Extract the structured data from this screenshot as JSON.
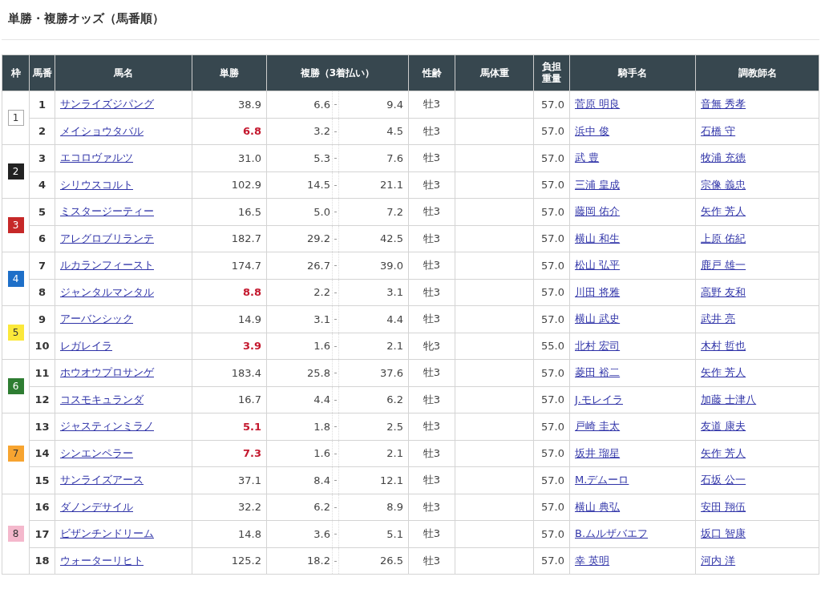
{
  "title": "単勝・複勝オッズ（馬番順）",
  "columns": [
    "枠",
    "馬番",
    "馬名",
    "単勝",
    "複勝（3着払い）",
    "性齢",
    "馬体重",
    "負担重量",
    "騎手名",
    "調教師名"
  ],
  "brackets": [
    {
      "number": "1",
      "color": "#ffffff",
      "horses": [
        {
          "no": "1",
          "name": "サンライズジパング",
          "win": "38.9",
          "highlight": false,
          "place_low": "6.6",
          "sep": "-",
          "place_high": "9.4",
          "sex_age": "牡3",
          "weight": "57.0",
          "jockey": "菅原 明良",
          "trainer": "音無 秀孝"
        },
        {
          "no": "2",
          "name": "メイショウタバル",
          "win": "6.8",
          "highlight": true,
          "place_low": "3.2",
          "sep": "-",
          "place_high": "4.5",
          "sex_age": "牡3",
          "weight": "57.0",
          "jockey": "浜中 俊",
          "trainer": "石橋 守"
        }
      ]
    },
    {
      "number": "2",
      "color": "#222222",
      "horses": [
        {
          "no": "3",
          "name": "エコロヴァルツ",
          "win": "31.0",
          "highlight": false,
          "place_low": "5.3",
          "sep": "-",
          "place_high": "7.6",
          "sex_age": "牡3",
          "weight": "57.0",
          "jockey": "武 豊",
          "trainer": "牧浦 充徳"
        },
        {
          "no": "4",
          "name": "シリウスコルト",
          "win": "102.9",
          "highlight": false,
          "place_low": "14.5",
          "sep": "-",
          "place_high": "21.1",
          "sex_age": "牡3",
          "weight": "57.0",
          "jockey": "三浦 皇成",
          "trainer": "宗像 義忠"
        }
      ]
    },
    {
      "number": "3",
      "color": "#c62828",
      "horses": [
        {
          "no": "5",
          "name": "ミスタージーティー",
          "win": "16.5",
          "highlight": false,
          "place_low": "5.0",
          "sep": "-",
          "place_high": "7.2",
          "sex_age": "牡3",
          "weight": "57.0",
          "jockey": "藤岡 佑介",
          "trainer": "矢作 芳人"
        },
        {
          "no": "6",
          "name": "アレグロブリランテ",
          "win": "182.7",
          "highlight": false,
          "place_low": "29.2",
          "sep": "-",
          "place_high": "42.5",
          "sex_age": "牡3",
          "weight": "57.0",
          "jockey": "横山 和生",
          "trainer": "上原 佑紀"
        }
      ]
    },
    {
      "number": "4",
      "color": "#1e6fc8",
      "horses": [
        {
          "no": "7",
          "name": "ルカランフィースト",
          "win": "174.7",
          "highlight": false,
          "place_low": "26.7",
          "sep": "-",
          "place_high": "39.0",
          "sex_age": "牡3",
          "weight": "57.0",
          "jockey": "松山 弘平",
          "trainer": "鹿戸 雄一"
        },
        {
          "no": "8",
          "name": "ジャンタルマンタル",
          "win": "8.8",
          "highlight": true,
          "place_low": "2.2",
          "sep": "-",
          "place_high": "3.1",
          "sex_age": "牡3",
          "weight": "57.0",
          "jockey": "川田 将雅",
          "trainer": "高野 友和"
        }
      ]
    },
    {
      "number": "5",
      "color": "#fbe83a",
      "horses": [
        {
          "no": "9",
          "name": "アーバンシック",
          "win": "14.9",
          "highlight": false,
          "place_low": "3.1",
          "sep": "-",
          "place_high": "4.4",
          "sex_age": "牡3",
          "weight": "57.0",
          "jockey": "横山 武史",
          "trainer": "武井 亮"
        },
        {
          "no": "10",
          "name": "レガレイラ",
          "win": "3.9",
          "highlight": true,
          "place_low": "1.6",
          "sep": "-",
          "place_high": "2.1",
          "sex_age": "牝3",
          "weight": "55.0",
          "jockey": "北村 宏司",
          "trainer": "木村 哲也"
        }
      ]
    },
    {
      "number": "6",
      "color": "#2e7d32",
      "horses": [
        {
          "no": "11",
          "name": "ホウオウプロサンゲ",
          "win": "183.4",
          "highlight": false,
          "place_low": "25.8",
          "sep": "-",
          "place_high": "37.6",
          "sex_age": "牡3",
          "weight": "57.0",
          "jockey": "菱田 裕二",
          "trainer": "矢作 芳人"
        },
        {
          "no": "12",
          "name": "コスモキュランダ",
          "win": "16.7",
          "highlight": false,
          "place_low": "4.4",
          "sep": "-",
          "place_high": "6.2",
          "sex_age": "牡3",
          "weight": "57.0",
          "jockey": "J.モレイラ",
          "trainer": "加藤 士津八"
        }
      ]
    },
    {
      "number": "7",
      "color": "#f7a430",
      "horses": [
        {
          "no": "13",
          "name": "ジャスティンミラノ",
          "win": "5.1",
          "highlight": true,
          "place_low": "1.8",
          "sep": "-",
          "place_high": "2.5",
          "sex_age": "牡3",
          "weight": "57.0",
          "jockey": "戸崎 圭太",
          "trainer": "友道 康夫"
        },
        {
          "no": "14",
          "name": "シンエンペラー",
          "win": "7.3",
          "highlight": true,
          "place_low": "1.6",
          "sep": "-",
          "place_high": "2.1",
          "sex_age": "牡3",
          "weight": "57.0",
          "jockey": "坂井 瑠星",
          "trainer": "矢作 芳人"
        },
        {
          "no": "15",
          "name": "サンライズアース",
          "win": "37.1",
          "highlight": false,
          "place_low": "8.4",
          "sep": "-",
          "place_high": "12.1",
          "sex_age": "牡3",
          "weight": "57.0",
          "jockey": "M.デムーロ",
          "trainer": "石坂 公一"
        }
      ]
    },
    {
      "number": "8",
      "color": "#f4b8cc",
      "horses": [
        {
          "no": "16",
          "name": "ダノンデサイル",
          "win": "32.2",
          "highlight": false,
          "place_low": "6.2",
          "sep": "-",
          "place_high": "8.9",
          "sex_age": "牡3",
          "weight": "57.0",
          "jockey": "横山 典弘",
          "trainer": "安田 翔伍"
        },
        {
          "no": "17",
          "name": "ビザンチンドリーム",
          "win": "14.8",
          "highlight": false,
          "place_low": "3.6",
          "sep": "-",
          "place_high": "5.1",
          "sex_age": "牡3",
          "weight": "57.0",
          "jockey": "B.ムルザバエフ",
          "trainer": "坂口 智康"
        },
        {
          "no": "18",
          "name": "ウォーターリヒト",
          "win": "125.2",
          "highlight": false,
          "place_low": "18.2",
          "sep": "-",
          "place_high": "26.5",
          "sex_age": "牡3",
          "weight": "57.0",
          "jockey": "幸 英明",
          "trainer": "河内 洋"
        }
      ]
    }
  ]
}
